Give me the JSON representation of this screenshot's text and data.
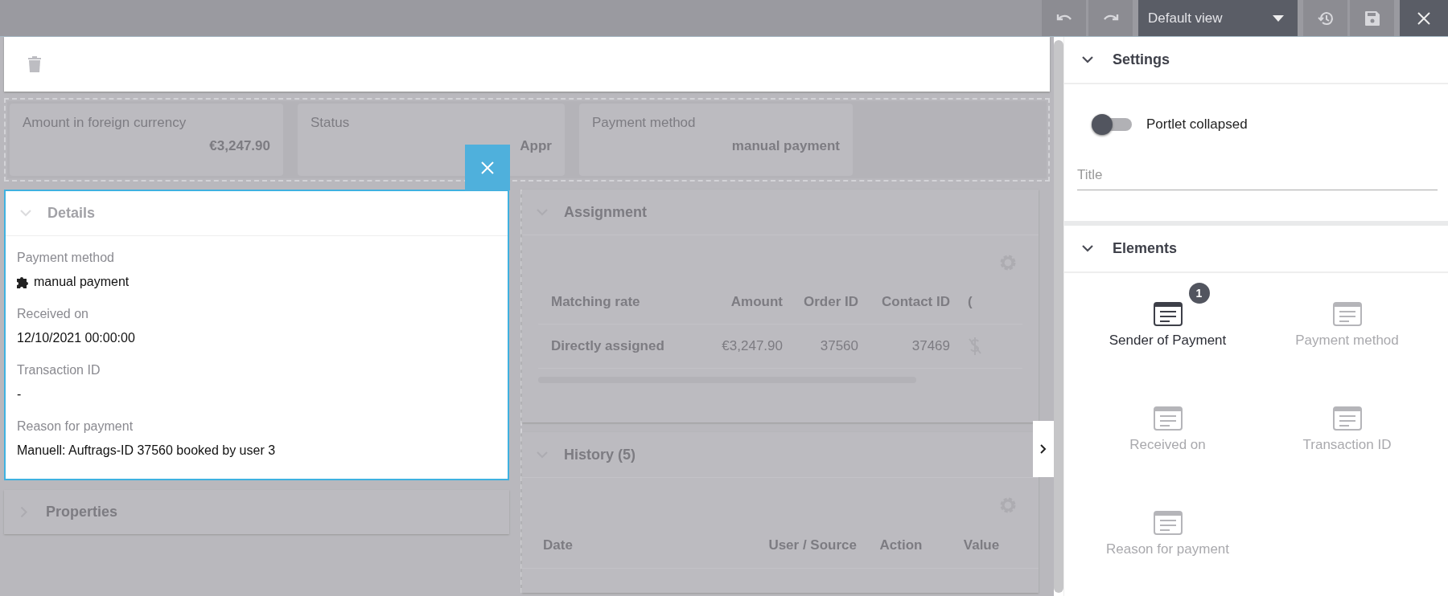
{
  "toolbar": {
    "view_select": "Default view"
  },
  "summary_tiles": [
    {
      "label": "Amount in foreign currency",
      "value": "€3,247.90"
    },
    {
      "label": "Status",
      "value": "Appr"
    },
    {
      "label": "Payment method",
      "value": "manual payment"
    }
  ],
  "details": {
    "title": "Details",
    "expanded": true,
    "fields": [
      {
        "label": "Payment method",
        "value": "manual payment",
        "kind": "icon"
      },
      {
        "label": "Received on",
        "value": "12/10/2021 00:00:00",
        "kind": "text"
      },
      {
        "label": "Transaction ID",
        "value": "-",
        "kind": "text"
      },
      {
        "label": "Reason for payment",
        "value": "Manuell: Auftrags-ID 37560 booked by user 3",
        "kind": "text"
      }
    ]
  },
  "properties": {
    "title": "Properties",
    "expanded": false
  },
  "assignment": {
    "title": "Assignment",
    "expanded": true,
    "columns": [
      "Matching rate",
      "Amount",
      "Order ID",
      "Contact ID",
      "("
    ],
    "rows": [
      {
        "cells": [
          "Directly assigned",
          "€3,247.90",
          "37560",
          "37469"
        ]
      }
    ]
  },
  "history": {
    "title": "History (5)",
    "expanded": true,
    "columns": [
      "Date",
      "User / Source",
      "Action",
      "Value"
    ]
  },
  "settings_panel": {
    "title": "Settings",
    "expanded": true,
    "toggle": {
      "label": "Portlet collapsed",
      "on": false
    },
    "title_field": {
      "placeholder": "Title"
    }
  },
  "elements_panel": {
    "title": "Elements",
    "expanded": true,
    "items": [
      {
        "label": "Sender of Payment",
        "active": true,
        "badge": "1"
      },
      {
        "label": "Payment method",
        "active": false
      },
      {
        "label": "Received on",
        "active": false
      },
      {
        "label": "Transaction ID",
        "active": false
      },
      {
        "label": "Reason for payment",
        "active": false
      }
    ]
  }
}
